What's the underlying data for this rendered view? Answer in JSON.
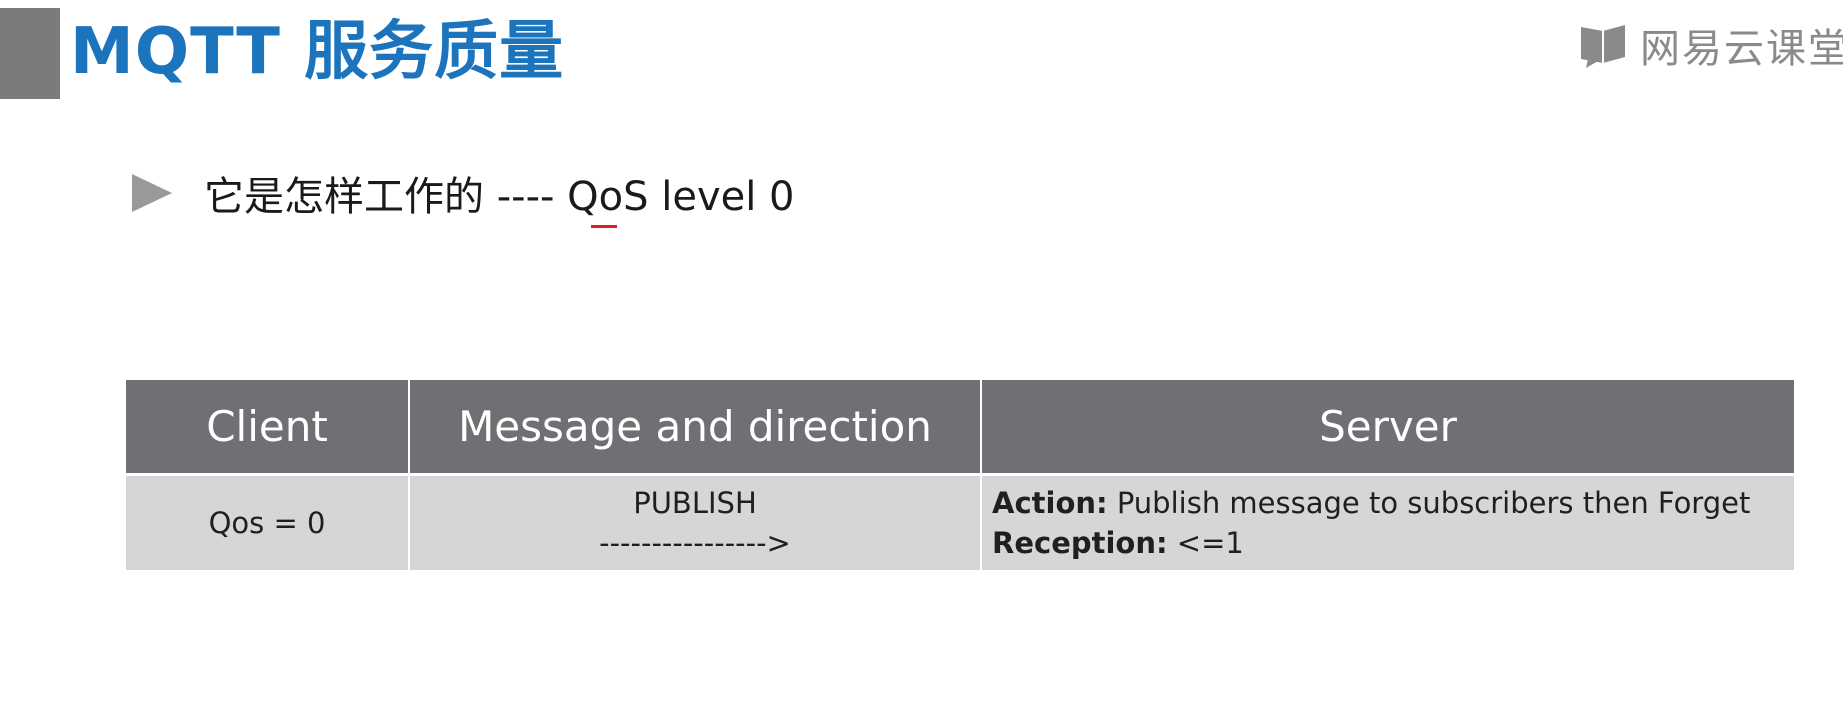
{
  "slide": {
    "title": "MQTT 服务质量",
    "logo_text": "网易云课堂",
    "heading": "它是怎样工作的 ---- QoS level 0"
  },
  "table": {
    "headers": [
      "Client",
      "Message and direction",
      "Server"
    ],
    "row": {
      "client": "Qos = 0",
      "message": "PUBLISH",
      "direction": "---------------->",
      "action_label": "Action:",
      "action_value": " Publish message to subscribers then Forget",
      "reception_label": "Reception:",
      "reception_value": " <=1"
    }
  },
  "colors": {
    "title": "#1c74bd",
    "header_bg": "#6f7073",
    "row_bg": "#d6d6d6",
    "accent_bar": "#7b7b7b",
    "underline_mark": "#e01e1e"
  },
  "icons": [
    "play-triangle-icon",
    "logo-book-icon"
  ]
}
